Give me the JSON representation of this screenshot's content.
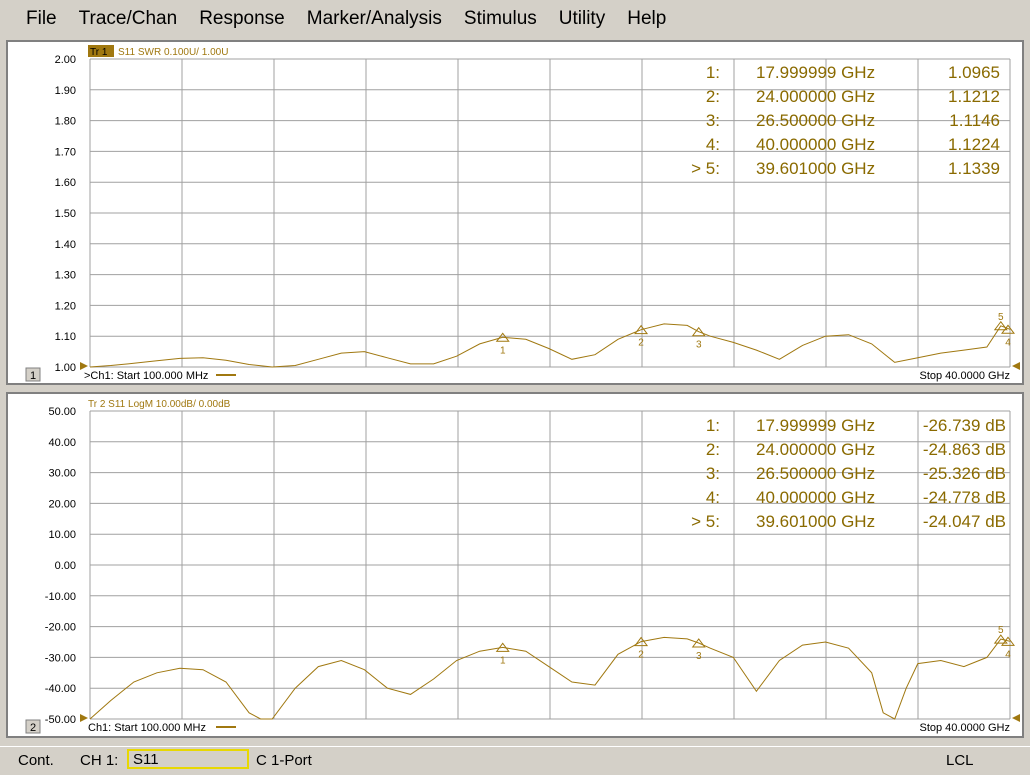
{
  "menu": [
    "File",
    "Trace/Chan",
    "Response",
    "Marker/Analysis",
    "Stimulus",
    "Utility",
    "Help"
  ],
  "colors": {
    "trace": "#a07810",
    "grid": "#a0a0a0",
    "marker_text": "#8a6a00",
    "panel_bg": "#ffffff"
  },
  "panel1": {
    "index": "1",
    "trace_badge": "Tr 1",
    "trace_label": "S11 SWR 0.100U/ 1.00U",
    "start_label": ">Ch1: Start  100.000 MHz",
    "stop_label": "Stop  40.0000 GHz",
    "markers": [
      {
        "id": "1:",
        "freq": "17.999999 GHz",
        "value": "1.0965"
      },
      {
        "id": "2:",
        "freq": "24.000000 GHz",
        "value": "1.1212"
      },
      {
        "id": "3:",
        "freq": "26.500000 GHz",
        "value": "1.1146"
      },
      {
        "id": "4:",
        "freq": "40.000000 GHz",
        "value": "1.1224"
      },
      {
        "id": "> 5:",
        "freq": "39.601000 GHz",
        "value": "1.1339"
      }
    ],
    "marker_labels": [
      "1",
      "2",
      "3",
      "4",
      "5"
    ]
  },
  "panel2": {
    "index": "2",
    "trace_label": "Tr 2  S11 LogM 10.00dB/  0.00dB",
    "start_label": "Ch1: Start  100.000 MHz",
    "stop_label": "Stop  40.0000 GHz",
    "markers": [
      {
        "id": "1:",
        "freq": "17.999999 GHz",
        "value": "-26.739 dB"
      },
      {
        "id": "2:",
        "freq": "24.000000 GHz",
        "value": "-24.863 dB"
      },
      {
        "id": "3:",
        "freq": "26.500000 GHz",
        "value": "-25.326 dB"
      },
      {
        "id": "4:",
        "freq": "40.000000 GHz",
        "value": "-24.778 dB"
      },
      {
        "id": "> 5:",
        "freq": "39.601000 GHz",
        "value": "-24.047 dB"
      }
    ],
    "marker_labels": [
      "1",
      "2",
      "3",
      "4",
      "5"
    ]
  },
  "status": {
    "mode": "Cont.",
    "channel": "CH 1:",
    "parameter": "S11",
    "cal": "C  1-Port",
    "remote": "LCL"
  },
  "chart_data": [
    {
      "type": "line",
      "x_unit": "GHz",
      "xlim": [
        0.1,
        40.0
      ],
      "ylim": [
        1.0,
        2.0
      ],
      "ytick_labels": [
        "2.00",
        "1.90",
        "1.80",
        "1.70",
        "1.60",
        "1.50",
        "1.40",
        "1.30",
        "1.20",
        "1.10",
        "1.00"
      ],
      "series": [
        {
          "x": [
            0.1,
            1,
            2,
            3,
            4,
            5,
            6,
            7,
            8,
            9,
            10,
            11,
            12,
            13,
            14,
            15,
            16,
            17,
            18,
            19,
            20,
            21,
            22,
            23,
            24,
            25,
            26,
            26.5,
            27,
            28,
            29,
            30,
            31,
            32,
            33,
            34,
            35,
            36,
            37,
            38,
            39,
            39.6,
            40
          ],
          "y": [
            1.0,
            1.005,
            1.012,
            1.02,
            1.028,
            1.03,
            1.022,
            1.008,
            1.0,
            1.005,
            1.025,
            1.045,
            1.05,
            1.03,
            1.01,
            1.01,
            1.035,
            1.075,
            1.0965,
            1.09,
            1.06,
            1.025,
            1.04,
            1.09,
            1.1212,
            1.14,
            1.135,
            1.1146,
            1.1,
            1.08,
            1.055,
            1.025,
            1.07,
            1.1,
            1.105,
            1.075,
            1.015,
            1.03,
            1.045,
            1.055,
            1.065,
            1.1339,
            1.1224
          ]
        }
      ],
      "markers": [
        {
          "x": 17.999999,
          "y": 1.0965
        },
        {
          "x": 24.0,
          "y": 1.1212
        },
        {
          "x": 26.5,
          "y": 1.1146
        },
        {
          "x": 40.0,
          "y": 1.1224
        },
        {
          "x": 39.601,
          "y": 1.1339
        }
      ]
    },
    {
      "type": "line",
      "x_unit": "GHz",
      "xlim": [
        0.1,
        40.0
      ],
      "ylim": [
        -50,
        50
      ],
      "ytick_labels": [
        "50.00",
        "40.00",
        "30.00",
        "20.00",
        "10.00",
        "0.00",
        "-10.00",
        "-20.00",
        "-30.00",
        "-40.00",
        "-50.00"
      ],
      "series": [
        {
          "x": [
            0.1,
            1,
            2,
            3,
            4,
            5,
            6,
            7,
            7.5,
            8,
            9,
            10,
            11,
            12,
            13,
            14,
            15,
            16,
            17,
            18,
            19,
            20,
            21,
            22,
            23,
            24,
            25,
            26,
            26.5,
            27,
            28,
            29,
            30,
            31,
            32,
            33,
            34,
            34.5,
            35,
            35.5,
            36,
            37,
            38,
            39,
            39.6,
            40
          ],
          "y": [
            -50,
            -44,
            -38,
            -35,
            -33.5,
            -34,
            -38,
            -48,
            -52,
            -52,
            -40,
            -33,
            -31,
            -34,
            -40,
            -42,
            -37,
            -31,
            -28,
            -26.739,
            -28,
            -33,
            -38,
            -39,
            -29,
            -24.863,
            -23.5,
            -24,
            -25.326,
            -27,
            -30,
            -41,
            -31,
            -26,
            -25,
            -27,
            -35,
            -48,
            -51,
            -40,
            -32,
            -31,
            -33,
            -30,
            -24.047,
            -24.778
          ]
        }
      ],
      "markers": [
        {
          "x": 17.999999,
          "y": -26.739
        },
        {
          "x": 24.0,
          "y": -24.863
        },
        {
          "x": 26.5,
          "y": -25.326
        },
        {
          "x": 40.0,
          "y": -24.778
        },
        {
          "x": 39.601,
          "y": -24.047
        }
      ]
    }
  ]
}
